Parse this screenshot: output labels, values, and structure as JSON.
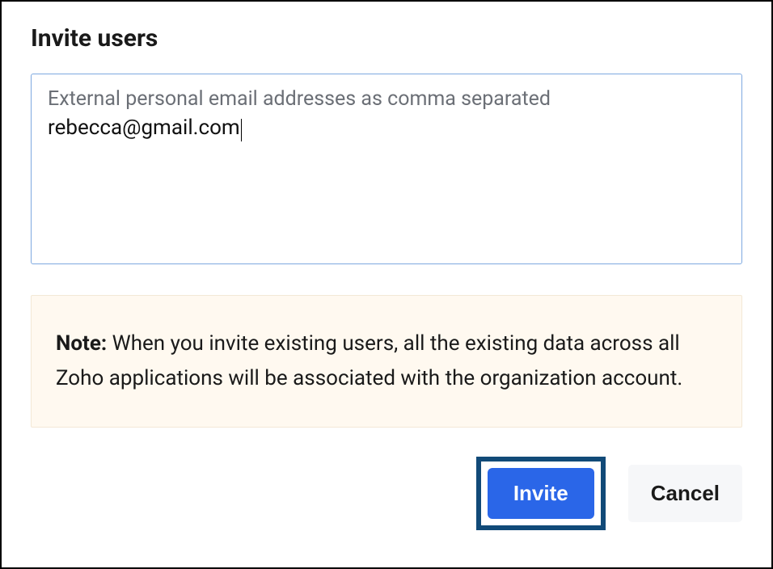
{
  "title": "Invite users",
  "emailField": {
    "label": "External personal email addresses as comma separated",
    "value": "rebecca@gmail.com"
  },
  "note": {
    "prefix": "Note:",
    "body": " When you invite existing users, all the existing data across all Zoho applications will be associated with the organization account."
  },
  "buttons": {
    "invite": "Invite",
    "cancel": "Cancel"
  },
  "colors": {
    "highlightBorder": "#114a78",
    "primaryButton": "#2a66e8",
    "noteBackground": "#fff9f0",
    "inputBorder": "#7ea9e0"
  }
}
